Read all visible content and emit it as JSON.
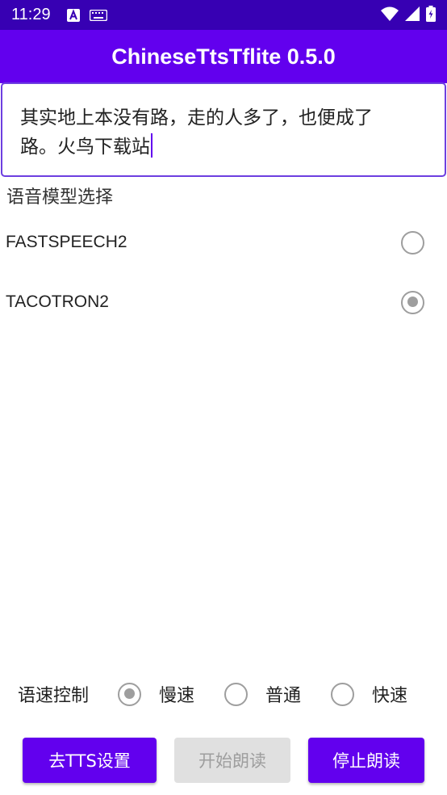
{
  "status_bar": {
    "time": "11:29",
    "icons": [
      "a-notification-icon",
      "keyboard-icon",
      "wifi-icon",
      "signal-icon",
      "battery-icon"
    ]
  },
  "app_bar": {
    "title": "ChineseTtsTflite 0.5.0"
  },
  "text_input": {
    "line1": "其实地上本没有路，走的人多了，也便成了",
    "line2": "路。火鸟下载站"
  },
  "model_section": {
    "label": "语音模型选择",
    "options": [
      {
        "label": "FASTSPEECH2",
        "checked": false
      },
      {
        "label": "TACOTRON2",
        "checked": true
      }
    ]
  },
  "speed_section": {
    "label": "语速控制",
    "options": [
      {
        "label": "慢速",
        "checked": true
      },
      {
        "label": "普通",
        "checked": false
      },
      {
        "label": "快速",
        "checked": false
      }
    ]
  },
  "buttons": {
    "settings": "去TTS设置",
    "start": "开始朗读",
    "stop": "停止朗读"
  },
  "colors": {
    "status_bar": "#3700b3",
    "app_bar": "#6200ee",
    "accent": "#6200ee",
    "radio": "#9e9e9e",
    "disabled_button": "#e0e0e0"
  }
}
